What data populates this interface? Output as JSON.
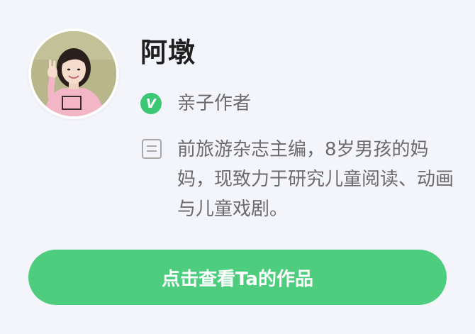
{
  "profile": {
    "name": "阿墩",
    "role": "亲子作者",
    "verified_badge": "V",
    "bio": "前旅游杂志主编，8岁男孩的妈妈，现致力于研究儿童阅读、动画与儿童戏剧。",
    "avatar_icon": "avatar-photo",
    "bio_icon": "document-icon"
  },
  "action": {
    "view_works_label": "点击查看Ta的作品"
  },
  "colors": {
    "background": "#f4f5fa",
    "accent": "#4dcd7d",
    "verified": "#3cc775",
    "name_text": "#1f1f1f",
    "secondary_text": "#6b6b6b"
  }
}
